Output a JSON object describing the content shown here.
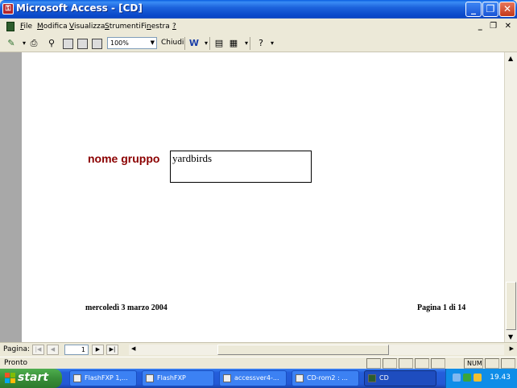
{
  "window": {
    "title": "Microsoft Access - [CD]",
    "app_icon": "access-key-icon",
    "buttons": [
      "minimize",
      "restore",
      "close"
    ]
  },
  "menubar": {
    "items": [
      {
        "label": "File",
        "accel": "F"
      },
      {
        "label": "Modifica",
        "accel": "M"
      },
      {
        "label": "Visualizza",
        "accel": "V"
      },
      {
        "label": "Strumenti",
        "accel": "S"
      },
      {
        "label": "Finestra",
        "accel": "n"
      },
      {
        "label": "?",
        "accel": "?"
      }
    ]
  },
  "toolbar": {
    "zoom": "100%",
    "close_label": "Chiudi"
  },
  "report": {
    "field_label": "nome gruppo",
    "field_value": "yardbirds",
    "footer_date": "mercoledì 3 marzo 2004",
    "footer_page": "Pagina 1 di 14"
  },
  "navigation": {
    "label": "Pagina:",
    "current_page": "1"
  },
  "statusbar": {
    "text": "Pronto",
    "num_indicator": "NUM"
  },
  "taskbar": {
    "start_label": "start",
    "tasks": [
      {
        "label": "FlashFXP 1,...",
        "active": false
      },
      {
        "label": "FlashFXP",
        "active": false
      },
      {
        "label": "accessver4-...",
        "active": false
      },
      {
        "label": "CD-rom2 : ...",
        "active": false
      },
      {
        "label": "CD",
        "active": true
      }
    ],
    "clock": "19.43"
  },
  "colors": {
    "titlebar": "#0846c8",
    "field_label": "#8b0000",
    "taskbar": "#245edb",
    "start": "#388e38"
  }
}
